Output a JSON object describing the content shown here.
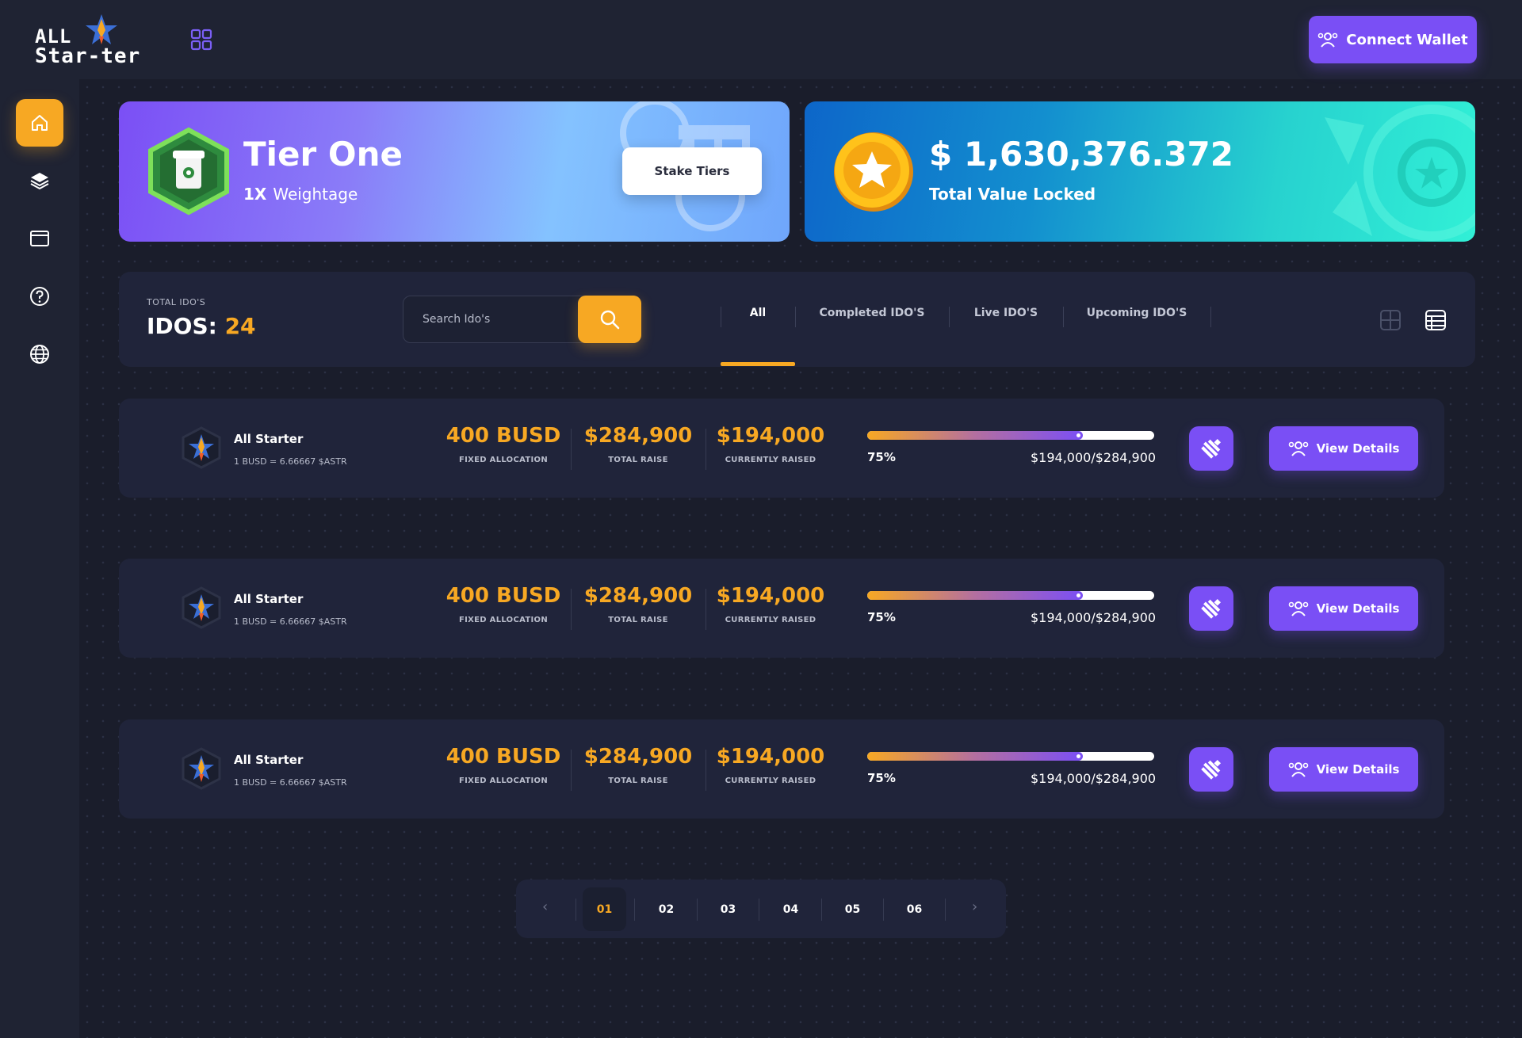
{
  "header": {
    "logo_line1": "ALL",
    "logo_line2": "Star-ter",
    "connect_wallet_label": "Connect Wallet"
  },
  "sidebar": {
    "items": [
      {
        "icon": "home-icon",
        "active": true
      },
      {
        "icon": "layers-icon",
        "active": false
      },
      {
        "icon": "window-icon",
        "active": false
      },
      {
        "icon": "help-icon",
        "active": false
      },
      {
        "icon": "globe-icon",
        "active": false
      }
    ]
  },
  "tier_card": {
    "title": "Tier One",
    "weight_value": "1X",
    "weight_label": "Weightage",
    "stake_button_label": "Stake Tiers"
  },
  "tvl_card": {
    "value": "$ 1,630,376.372",
    "label": "Total Value Locked"
  },
  "filter": {
    "total_label": "TOTAL IDO'S",
    "idos_prefix": "IDOS:",
    "idos_count": "24",
    "search_placeholder": "Search Ido's",
    "tabs": [
      {
        "label": "All",
        "active": true
      },
      {
        "label": "Completed IDO'S",
        "active": false
      },
      {
        "label": "Live IDO'S",
        "active": false
      },
      {
        "label": "Upcoming IDO'S",
        "active": false
      }
    ]
  },
  "idos": [
    {
      "name": "All Starter",
      "rate": "1 BUSD = 6.66667 $ASTR",
      "allocation": "400 BUSD",
      "allocation_label": "FIXED ALLOCATION",
      "total_raise": "$284,900",
      "total_raise_label": "TOTAL RAISE",
      "current_raised": "$194,000",
      "current_raised_label": "CURRENTLY RAISED",
      "progress": 0.75,
      "progress_pct": "75%",
      "raised_ratio": "$194,000/$284,900",
      "details_label": "View Details"
    },
    {
      "name": "All Starter",
      "rate": "1 BUSD = 6.66667 $ASTR",
      "allocation": "400 BUSD",
      "allocation_label": "FIXED ALLOCATION",
      "total_raise": "$284,900",
      "total_raise_label": "TOTAL RAISE",
      "current_raised": "$194,000",
      "current_raised_label": "CURRENTLY RAISED",
      "progress": 0.75,
      "progress_pct": "75%",
      "raised_ratio": "$194,000/$284,900",
      "details_label": "View Details"
    },
    {
      "name": "All Starter",
      "rate": "1 BUSD = 6.66667 $ASTR",
      "allocation": "400 BUSD",
      "allocation_label": "FIXED ALLOCATION",
      "total_raise": "$284,900",
      "total_raise_label": "TOTAL RAISE",
      "current_raised": "$194,000",
      "current_raised_label": "CURRENTLY RAISED",
      "progress": 0.75,
      "progress_pct": "75%",
      "raised_ratio": "$194,000/$284,900",
      "details_label": "View Details"
    }
  ],
  "pagination": {
    "prev": "‹",
    "next": "›",
    "pages": [
      "01",
      "02",
      "03",
      "04",
      "05",
      "06"
    ],
    "active_page": "01"
  },
  "colors": {
    "accent_orange": "#f7a823",
    "accent_purple": "#7a4ff5",
    "card_bg": "#20243a",
    "page_bg": "#1a1d2b"
  }
}
